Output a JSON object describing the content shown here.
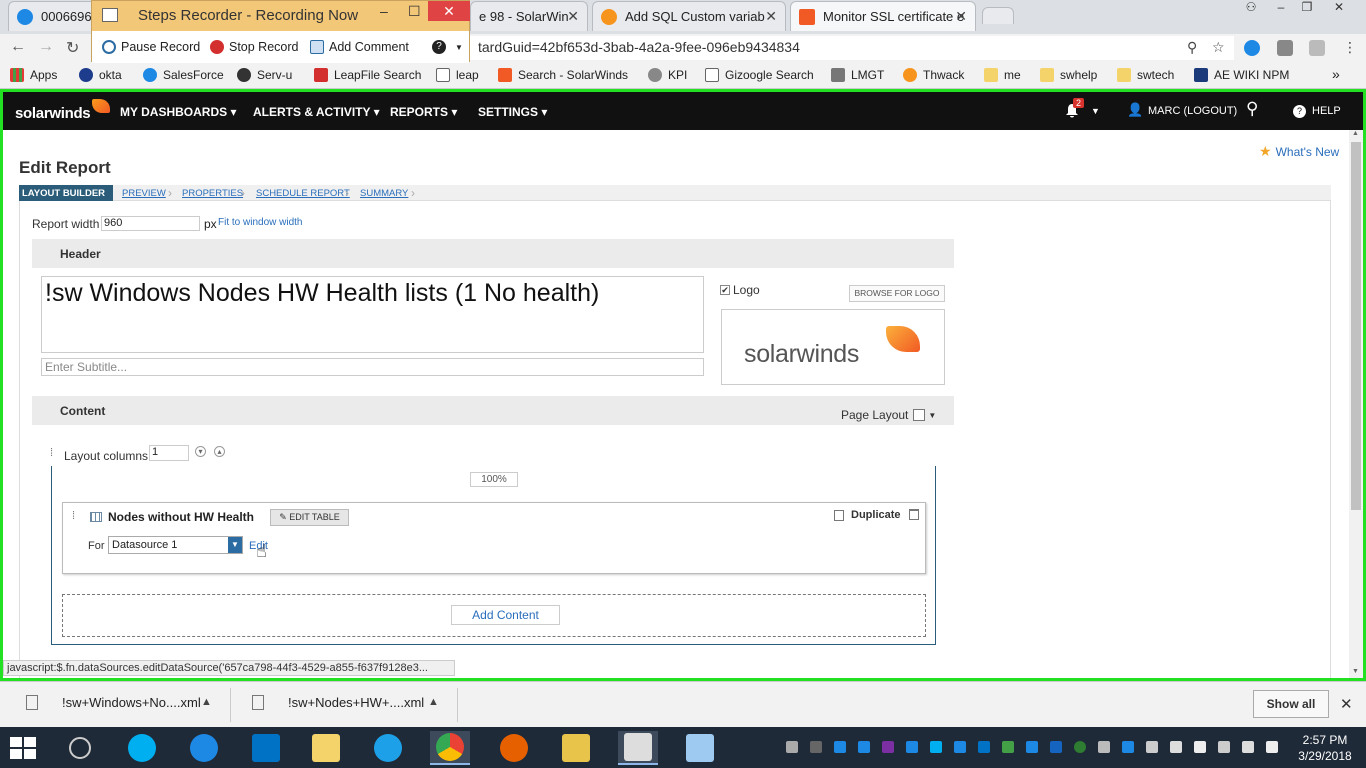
{
  "browser": {
    "tabs": [
      {
        "label": "0006696",
        "color": "#1e88e5"
      },
      {
        "label": "e 98 - SolarWin",
        "color": "#f7941d"
      },
      {
        "label": "Add SQL Custom variab",
        "color": "#f7941d"
      },
      {
        "label": "Monitor SSL certificate e",
        "color": "#f15a24"
      }
    ],
    "address": "tardGuid=42bf653d-3bab-4a2a-9fee-096eb9434834",
    "bookmarks": [
      "Apps",
      "okta",
      "SalesForce",
      "Serv-u",
      "LeapFile Search",
      "leap",
      "Search - SolarWinds",
      "KPI",
      "Gizoogle Search",
      "LMGT",
      "Thwack",
      "me",
      "swhelp",
      "swtech",
      "AE WIKI NPM"
    ],
    "bookmark_more": "»"
  },
  "recorder": {
    "title": "Steps Recorder - Recording Now",
    "pause": "Pause Record",
    "stop": "Stop Record",
    "comment": "Add Comment",
    "help": "?"
  },
  "solarwinds": {
    "logo": "solarwinds",
    "menu": [
      "MY DASHBOARDS",
      "ALERTS & ACTIVITY",
      "REPORTS",
      "SETTINGS"
    ],
    "notification_count": "2",
    "user": "MARC (LOGOUT)",
    "help": "HELP"
  },
  "page": {
    "title": "Edit Report",
    "whats_new": "What's New",
    "wizard_steps": [
      "LAYOUT BUILDER",
      "PREVIEW",
      "PROPERTIES",
      "SCHEDULE REPORT",
      "SUMMARY"
    ],
    "report_width_label": "Report width",
    "report_width_value": "960",
    "px": "px",
    "fit_link": "Fit to window width",
    "header_label": "Header",
    "report_title": "!sw Windows Nodes HW Health lists (1 No health)",
    "subtitle_placeholder": "Enter Subtitle...",
    "logo_label": "Logo",
    "logo_checked": true,
    "browse_logo": "BROWSE FOR LOGO",
    "logo_image_text": "solarwinds",
    "content_label": "Content",
    "page_layout_label": "Page Layout",
    "layout_columns_label": "Layout columns",
    "layout_columns_value": "1",
    "column_width": "100%",
    "resource": {
      "title": "Nodes without HW Health",
      "edit_table": "EDIT TABLE",
      "duplicate": "Duplicate",
      "for_label": "For",
      "datasource": "Datasource 1",
      "edit_link": "Edit"
    },
    "add_content": "Add Content",
    "status_url": "javascript:$.fn.dataSources.editDataSource('657ca798-44f3-4529-a855-f637f9128e3..."
  },
  "downloads": {
    "items": [
      "!sw+Windows+No....xml",
      "!sw+Nodes+HW+....xml"
    ],
    "show_all": "Show all"
  },
  "taskbar": {
    "time": "2:57 PM",
    "date": "3/29/2018"
  }
}
